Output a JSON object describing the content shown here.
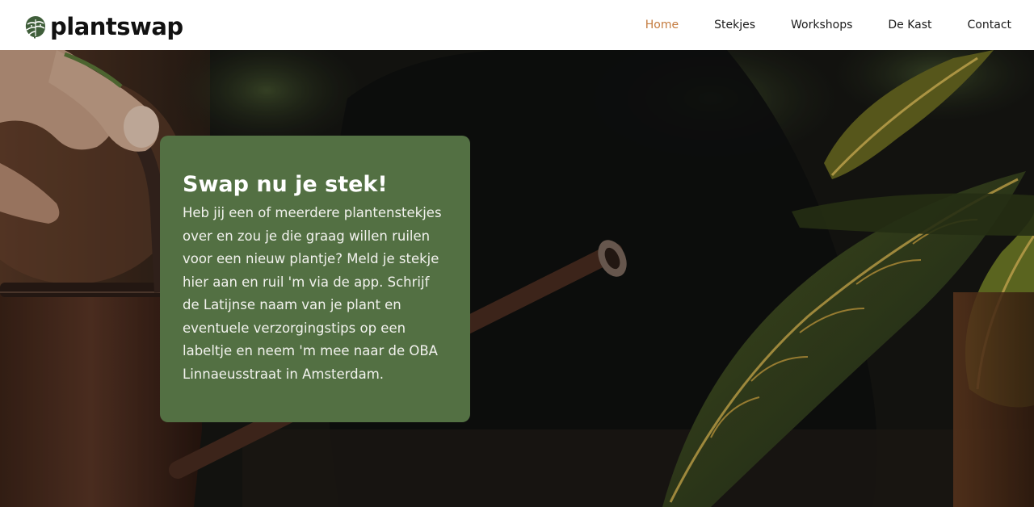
{
  "brand": {
    "name": "plantswap",
    "logo_icon": "monstera-leaf-icon"
  },
  "nav": {
    "items": [
      {
        "label": "Home",
        "active": true
      },
      {
        "label": "Stekjes",
        "active": false
      },
      {
        "label": "Workshops",
        "active": false
      },
      {
        "label": "De Kast",
        "active": false
      },
      {
        "label": "Contact",
        "active": false
      }
    ]
  },
  "hero": {
    "title": "Swap nu je stek!",
    "body": "Heb jij een of meerdere plantenstekjes over en zou je die graag willen ruilen voor een nieuw plantje? Meld je stekje hier aan en ruil 'm via de app. Schrijf de Latijnse naam van je plant en eventuele verzorgingstips op een labeltje en neem 'm mee naar de OBA Linnaeusstraat in Amsterdam."
  },
  "colors": {
    "accent": "#c47b3e",
    "card_bg": "#537043",
    "text_dark": "#111111"
  }
}
